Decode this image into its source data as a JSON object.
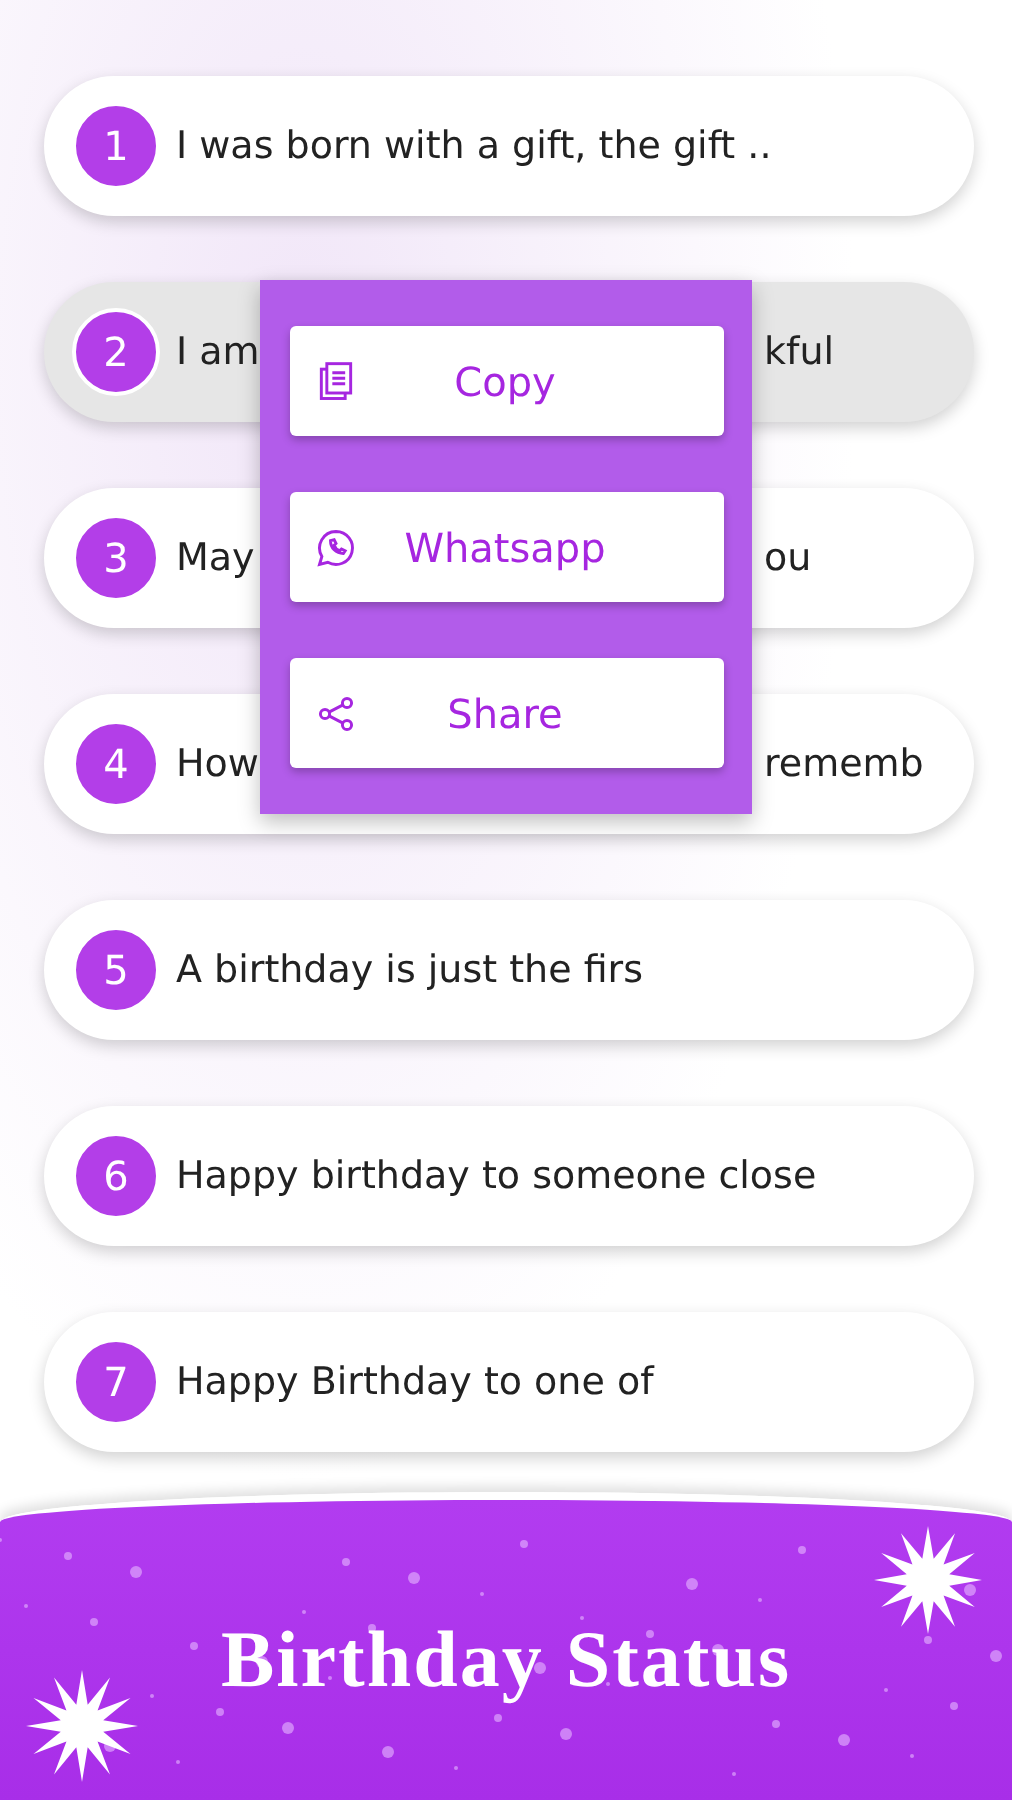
{
  "rows": [
    {
      "number": "1",
      "parts": [
        "I was born with a gift, the gift .."
      ],
      "selected": false
    },
    {
      "number": "2",
      "parts": [
        "I am",
        "kful"
      ],
      "selected": true
    },
    {
      "number": "3",
      "parts": [
        "May",
        "ou"
      ],
      "selected": false
    },
    {
      "number": "4",
      "parts": [
        "How",
        "rememb"
      ],
      "selected": false
    },
    {
      "number": "5",
      "parts": [
        "A birthday is just the firs"
      ],
      "selected": false
    },
    {
      "number": "6",
      "parts": [
        "Happy birthday to someone close"
      ],
      "selected": false
    },
    {
      "number": "7",
      "parts": [
        "Happy Birthday to one of"
      ],
      "selected": false
    }
  ],
  "menu": [
    {
      "kind": "copy",
      "label": "Copy"
    },
    {
      "kind": "whatsapp",
      "label": "Whatsapp"
    },
    {
      "kind": "share",
      "label": "Share"
    }
  ],
  "footer": {
    "title": "Birthday Status"
  }
}
